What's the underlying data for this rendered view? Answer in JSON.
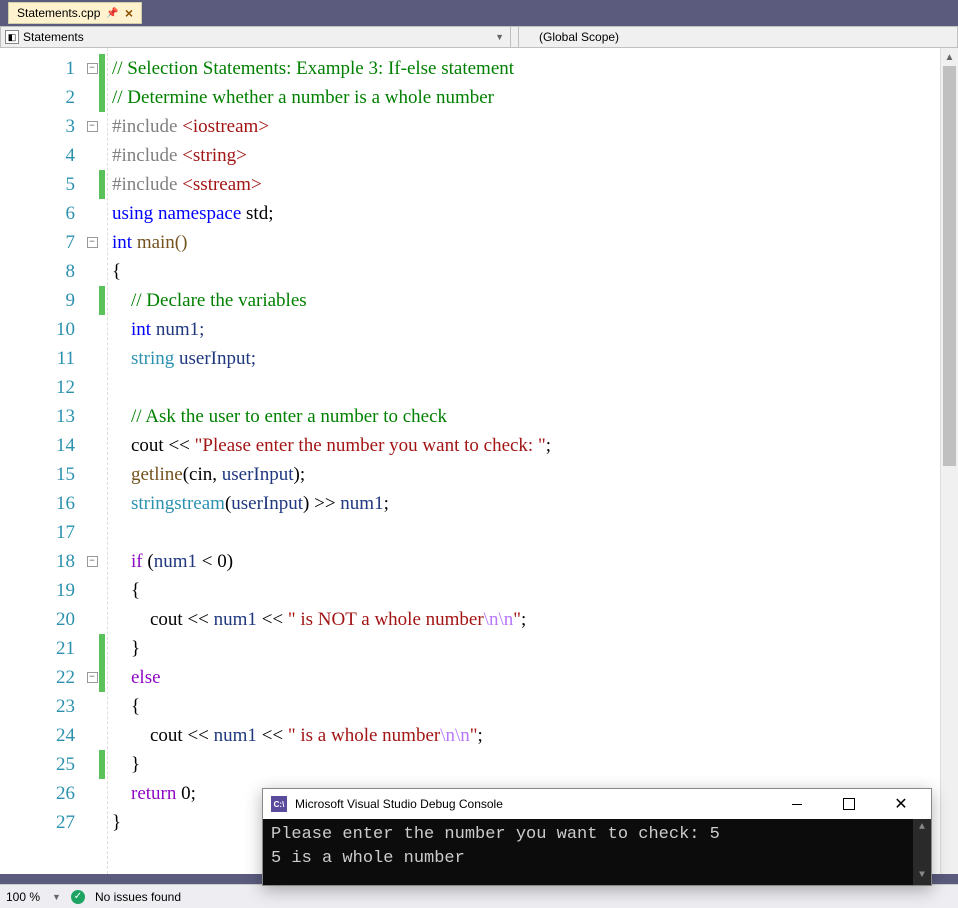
{
  "tab": {
    "label": "Statements.cpp"
  },
  "nav": {
    "left": "Statements",
    "right": "(Global Scope)"
  },
  "lines": [
    "1",
    "2",
    "3",
    "4",
    "5",
    "6",
    "7",
    "8",
    "9",
    "10",
    "11",
    "12",
    "13",
    "14",
    "15",
    "16",
    "17",
    "18",
    "19",
    "20",
    "21",
    "22",
    "23",
    "24",
    "25",
    "26",
    "27"
  ],
  "code": {
    "l1": "// Selection Statements: Example 3: If-else statement",
    "l2": "// Determine whether a number is a whole number",
    "l3_pp": "#include ",
    "l3_inc": "<iostream>",
    "l4_pp": "#include ",
    "l4_inc": "<string>",
    "l5_pp": "#include ",
    "l5_inc": "<sstream>",
    "l6_using": "using",
    "l6_ns": " namespace ",
    "l6_std": "std",
    "l6_semi": ";",
    "l7_int": "int",
    "l7_main": " main()",
    "l8": "{",
    "l9": "    // Declare the variables",
    "l10_int": "    int",
    "l10_rest": " num1;",
    "l11_type": "    string",
    "l11_rest": " userInput;",
    "l13": "    // Ask the user to enter a number to check",
    "l14_a": "    cout ",
    "l14_op": "<<",
    "l14_b": " ",
    "l14_str": "\"Please enter the number you want to check: \"",
    "l14_c": ";",
    "l15_a": "    getline(cin, userInput);",
    "l15_func": "getline",
    "l15_pre": "    ",
    "l15_open": "(",
    "l15_cin": "cin",
    "l15_comma": ", ",
    "l15_ui": "userInput",
    "l15_close": ");",
    "l16_pre": "    ",
    "l16_type": "stringstream",
    "l16_open": "(",
    "l16_ui": "userInput",
    "l16_close": ") ",
    "l16_op": ">>",
    "l16_sp": " ",
    "l16_num": "num1",
    "l16_semi": ";",
    "l18_pre": "    ",
    "l18_if": "if",
    "l18_cond_open": " (",
    "l18_num": "num1",
    "l18_lt": " < ",
    "l18_zero": "0",
    "l18_close": ")",
    "l19": "    {",
    "l20_pre": "        cout ",
    "l20_op": "<<",
    "l20_sp": " ",
    "l20_num": "num1",
    "l20_sp2": " ",
    "l20_op2": "<<",
    "l20_sp3": " ",
    "l20_str": "\" is NOT a whole number",
    "l20_esc": "\\n\\n",
    "l20_strend": "\"",
    "l20_semi": ";",
    "l21": "    }",
    "l22_pre": "    ",
    "l22_else": "else",
    "l23": "    {",
    "l24_pre": "        cout ",
    "l24_op": "<<",
    "l24_sp": " ",
    "l24_num": "num1",
    "l24_sp2": " ",
    "l24_op2": "<<",
    "l24_sp3": " ",
    "l24_str": "\" is a whole number",
    "l24_esc": "\\n\\n",
    "l24_strend": "\"",
    "l24_semi": ";",
    "l25": "    }",
    "l26_pre": "    ",
    "l26_ret": "return",
    "l26_sp": " ",
    "l26_zero": "0",
    "l26_semi": ";",
    "l27": "}"
  },
  "status": {
    "zoom": "100 %",
    "issues": "No issues found"
  },
  "console": {
    "title": "Microsoft Visual Studio Debug Console",
    "line1": "Please enter the number you want to check: 5",
    "line2": "5 is a whole number"
  }
}
